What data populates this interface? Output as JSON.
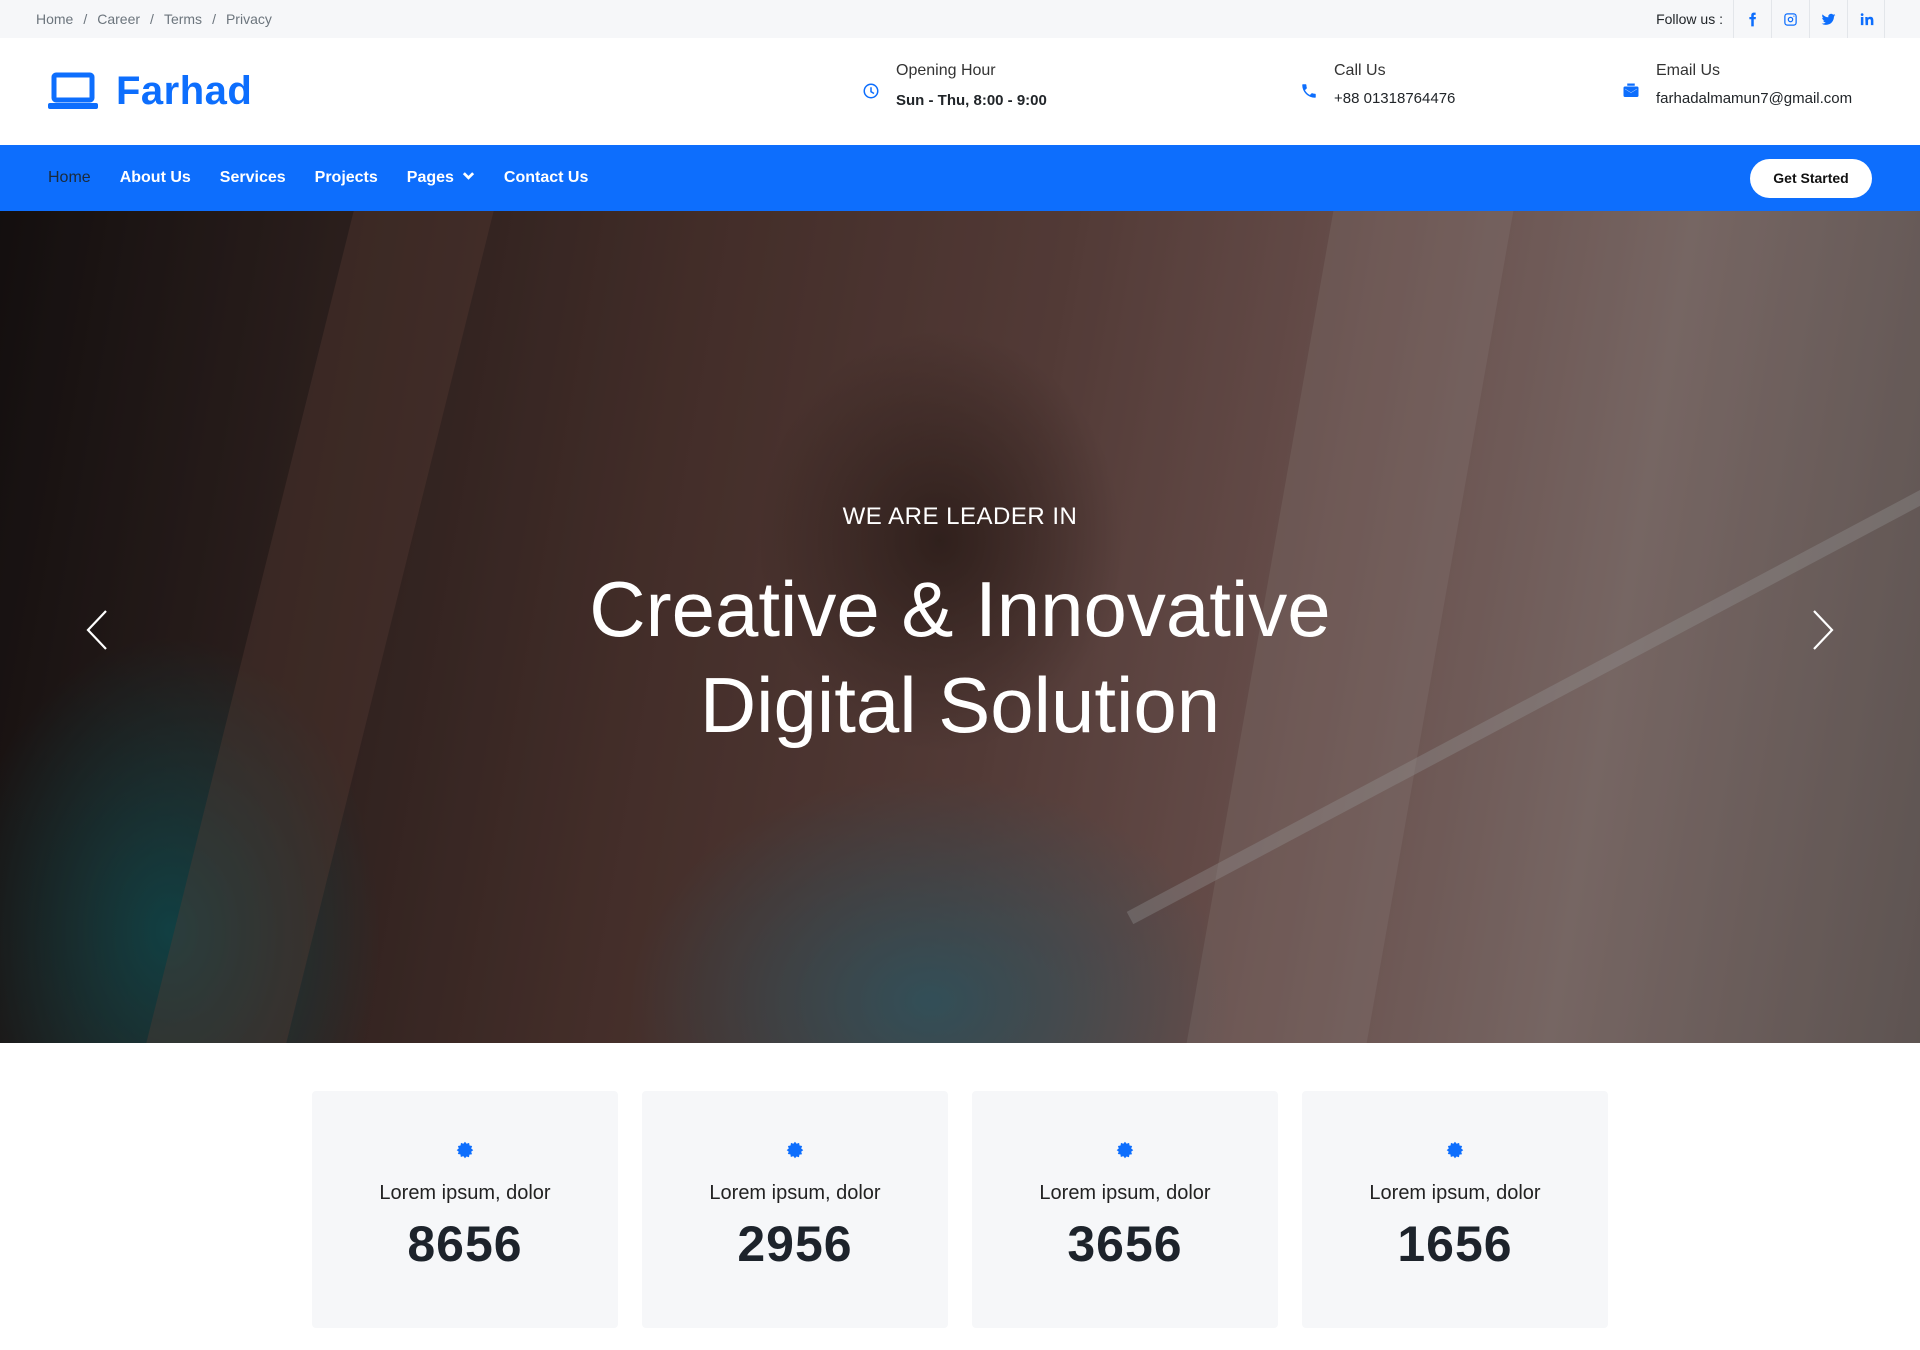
{
  "topbar": {
    "breadcrumbs": [
      "Home",
      "Career",
      "Terms",
      "Privacy"
    ],
    "separator": "/",
    "follow_label": "Follow us :",
    "social_icons": [
      "facebook-icon",
      "instagram-icon",
      "twitter-icon",
      "linkedin-icon"
    ]
  },
  "header": {
    "logo_text": "Farhad",
    "hours": {
      "title": "Opening Hour",
      "value": "Sun - Thu, 8:00 - 9:00"
    },
    "call": {
      "title": "Call Us",
      "value": "+88 01318764476"
    },
    "email": {
      "title": "Email Us",
      "value": "farhadalmamun7@gmail.com"
    }
  },
  "nav": {
    "items": [
      "Home",
      "About Us",
      "Services",
      "Projects",
      "Pages",
      "Contact Us"
    ],
    "active": "Home",
    "cta": "Get Started"
  },
  "hero": {
    "subtitle": "WE ARE LEADER IN",
    "title_line1": "Creative & Innovative",
    "title_line2": "Digital Solution"
  },
  "stats": [
    {
      "label": "Lorem ipsum, dolor",
      "value": "8656"
    },
    {
      "label": "Lorem ipsum, dolor",
      "value": "2956"
    },
    {
      "label": "Lorem ipsum, dolor",
      "value": "3656"
    },
    {
      "label": "Lorem ipsum, dolor",
      "value": "1656"
    }
  ],
  "colors": {
    "brand": "#0d6efd",
    "topbar_bg": "#f6f7f9",
    "card_bg": "#f6f7f9"
  }
}
